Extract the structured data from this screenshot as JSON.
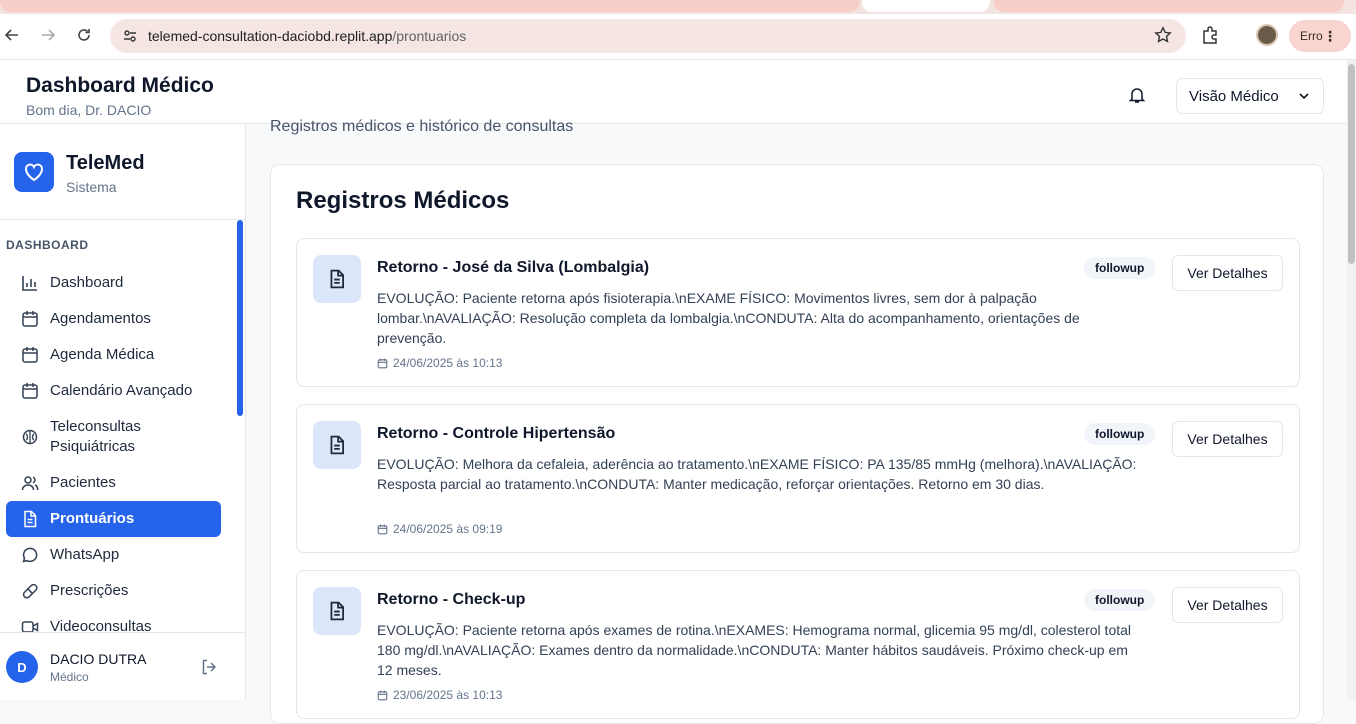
{
  "browser": {
    "url_host": "telemed-consultation-daciobd.replit.app",
    "url_path": "/prontuarios",
    "error_label": "Erro"
  },
  "header": {
    "title": "Dashboard Médico",
    "greeting": "Bom dia, Dr. DACIO",
    "view_select": "Visão Médico"
  },
  "sidebar": {
    "brand_name": "TeleMed",
    "brand_sub": "Sistema",
    "section": "DASHBOARD",
    "items": [
      {
        "label": "Dashboard",
        "icon": "bar-chart-icon"
      },
      {
        "label": "Agendamentos",
        "icon": "calendar-icon"
      },
      {
        "label": "Agenda Médica",
        "icon": "calendar-icon"
      },
      {
        "label": "Calendário Avançado",
        "icon": "calendar-icon"
      },
      {
        "label": "Teleconsultas Psiquiátricas",
        "icon": "brain-icon"
      },
      {
        "label": "Pacientes",
        "icon": "users-icon"
      },
      {
        "label": "Prontuários",
        "icon": "file-text-icon",
        "active": true
      },
      {
        "label": "WhatsApp",
        "icon": "message-circle-icon"
      },
      {
        "label": "Prescrições",
        "icon": "pill-icon"
      },
      {
        "label": "Videoconsultas",
        "icon": "video-icon"
      }
    ],
    "user": {
      "initial": "D",
      "name": "DACIO DUTRA",
      "role": "Médico"
    }
  },
  "main": {
    "subtitle": "Registros médicos e histórico de consultas",
    "heading": "Registros Médicos",
    "details_label": "Ver Detalhes",
    "records": [
      {
        "title": "Retorno - José da Silva (Lombalgia)",
        "description": "EVOLUÇÃO: Paciente retorna após fisioterapia.\\nEXAME FÍSICO: Movimentos livres, sem dor à palpação lombar.\\nAVALIAÇÃO: Resolução completa da lombalgia.\\nCONDUTA: Alta do acompanhamento, orientações de prevenção.",
        "badge": "followup",
        "date": "24/06/2025 às 10:13"
      },
      {
        "title": "Retorno - Controle Hipertensão",
        "description": "EVOLUÇÃO: Melhora da cefaleia, aderência ao tratamento.\\nEXAME FÍSICO: PA 135/85 mmHg (melhora).\\nAVALIAÇÃO: Resposta parcial ao tratamento.\\nCONDUTA: Manter medicação, reforçar orientações. Retorno em 30 dias.",
        "badge": "followup",
        "date": "24/06/2025 às 09:19"
      },
      {
        "title": "Retorno - Check-up",
        "description": "EVOLUÇÃO: Paciente retorna após exames de rotina.\\nEXAMES: Hemograma normal, glicemia 95 mg/dl, colesterol total 180 mg/dl.\\nAVALIAÇÃO: Exames dentro da normalidade.\\nCONDUTA: Manter hábitos saudáveis. Próximo check-up em 12 meses.",
        "badge": "followup",
        "date": "23/06/2025 às 10:13"
      }
    ]
  },
  "colors": {
    "accent": "#2563eb",
    "icon_bg": "#dbe6fb"
  }
}
